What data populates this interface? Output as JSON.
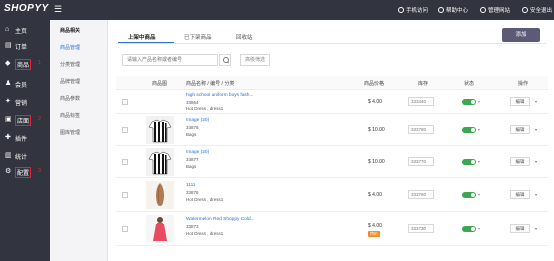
{
  "brand": "SHOPYY",
  "menu_toggle": "☰",
  "topbar": {
    "items": [
      {
        "label": "手机访问",
        "icon": "phone-icon"
      },
      {
        "label": "帮助中心",
        "icon": "help-icon"
      },
      {
        "label": "管理网站",
        "icon": "globe-icon"
      },
      {
        "label": "安全退出",
        "icon": "power-icon"
      }
    ]
  },
  "sidebar": {
    "items": [
      {
        "label": "主页",
        "icon": "⌂",
        "icon_name": "home-icon"
      },
      {
        "label": "订单",
        "icon": "▤",
        "icon_name": "order-icon"
      },
      {
        "label": "商品",
        "icon": "◆",
        "icon_name": "product-icon",
        "marker": "1"
      },
      {
        "label": "会员",
        "icon": "♟",
        "icon_name": "member-icon"
      },
      {
        "label": "营销",
        "icon": "✦",
        "icon_name": "marketing-icon"
      },
      {
        "label": "店面",
        "icon": "▣",
        "icon_name": "store-icon",
        "marker": "2"
      },
      {
        "label": "插件",
        "icon": "✚",
        "icon_name": "plugin-icon"
      },
      {
        "label": "统计",
        "icon": "▥",
        "icon_name": "stats-icon"
      },
      {
        "label": "配置",
        "icon": "⚙",
        "icon_name": "settings-icon",
        "marker": "3"
      }
    ]
  },
  "subnav": {
    "items": [
      {
        "label": "商品相关",
        "state": "head"
      },
      {
        "label": "商品管理",
        "state": "active"
      },
      {
        "label": "分类管理",
        "state": ""
      },
      {
        "label": "品牌管理",
        "state": ""
      },
      {
        "label": "商品参数",
        "state": ""
      },
      {
        "label": "商品标签",
        "state": ""
      },
      {
        "label": "图库管理",
        "state": ""
      }
    ]
  },
  "tabs": [
    {
      "label": "上架中商品"
    },
    {
      "label": "已下架商品"
    },
    {
      "label": "回收站"
    }
  ],
  "add_button": "添加",
  "search": {
    "placeholder": "请输入产品名称或者编号",
    "filter_label": "高级筛选"
  },
  "table": {
    "columns": [
      "商品图",
      "商品名称 / 编号 / 分类",
      "商品价格",
      "库存",
      "状态",
      "操作"
    ],
    "rows": [
      {
        "name": "high school uniform boys fash...",
        "id": "33864",
        "category": "Hot Dress , dress1",
        "price": "$ 4.00",
        "badge": "",
        "stock": "333440",
        "action": "编辑",
        "thumb": "none"
      },
      {
        "name": "Image (20)",
        "id": "33878",
        "category": "Bags",
        "price": "$ 10.00",
        "badge": "",
        "stock": "333780",
        "action": "编辑",
        "thumb": "jersey"
      },
      {
        "name": "Image (20)",
        "id": "33877",
        "category": "Bags",
        "price": "$ 10.00",
        "badge": "",
        "stock": "333770",
        "action": "编辑",
        "thumb": "jersey"
      },
      {
        "name": "1111",
        "id": "33876",
        "category": "Hot Dress , dress1",
        "price": "$ 4.00",
        "badge": "",
        "stock": "333760",
        "action": "编辑",
        "thumb": "hair"
      },
      {
        "name": "Watermelon Red Shoppy Cold...",
        "id": "33873",
        "category": "Hot Dress , dress1",
        "price": "$ 4.00",
        "badge": "特价",
        "stock": "333730",
        "action": "编辑",
        "thumb": "dress"
      }
    ]
  }
}
